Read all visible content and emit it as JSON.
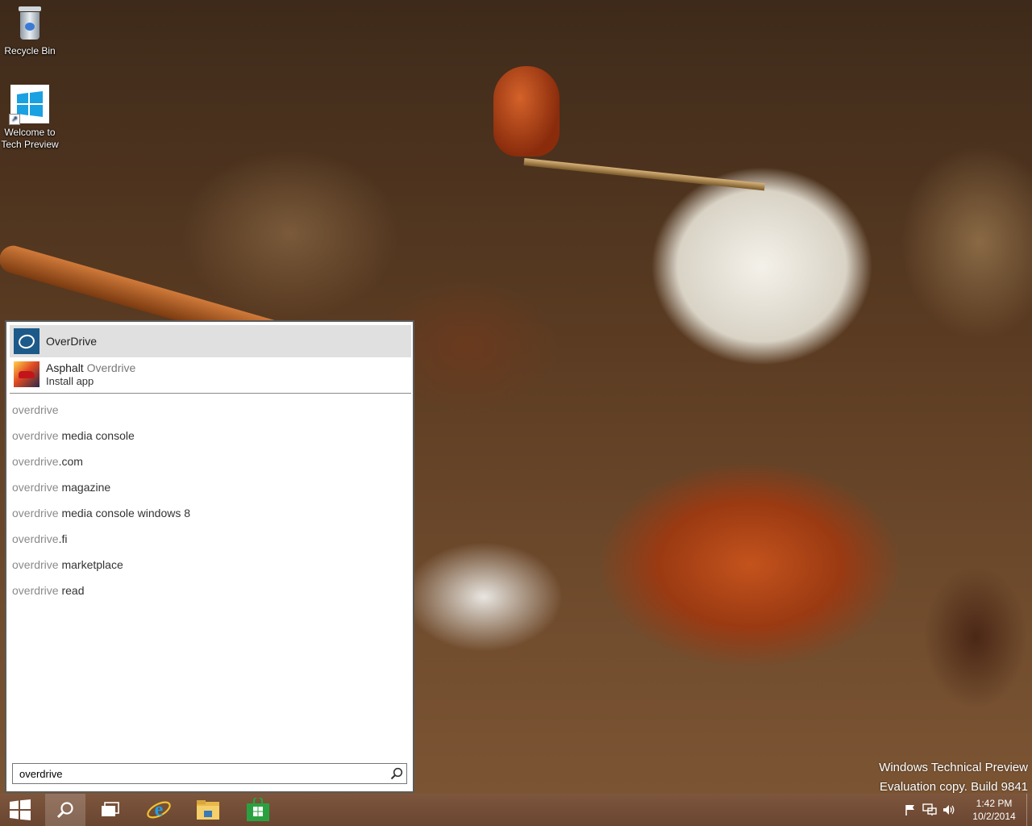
{
  "desktop": {
    "icons": [
      {
        "label": "Recycle Bin",
        "icon": "recycle-bin-icon"
      },
      {
        "label": "Welcome to Tech Preview",
        "icon": "windows-logo-icon"
      }
    ],
    "watermark": {
      "line1": "Windows Technical Preview",
      "line2": "Evaluation copy. Build 9841"
    }
  },
  "search_panel": {
    "results": [
      {
        "title": "OverDrive",
        "icon": "overdrive-app-icon",
        "selected": true
      },
      {
        "title_prefix": "Asphalt",
        "title_match": "Overdrive",
        "subtitle": "Install app",
        "icon": "asphalt-overdrive-icon"
      }
    ],
    "suggestions": [
      {
        "query": "overdrive",
        "rest": ""
      },
      {
        "query": "overdrive",
        "rest": " media console"
      },
      {
        "query": "overdrive",
        "rest": ".com"
      },
      {
        "query": "overdrive",
        "rest": " magazine"
      },
      {
        "query": "overdrive",
        "rest": " media console windows 8"
      },
      {
        "query": "overdrive",
        "rest": ".fi"
      },
      {
        "query": "overdrive",
        "rest": " marketplace"
      },
      {
        "query": "overdrive",
        "rest": " read"
      }
    ],
    "search_box": {
      "value": "overdrive",
      "icon": "search-icon"
    }
  },
  "taskbar": {
    "buttons": [
      {
        "name": "start-button",
        "icon": "windows-logo-icon"
      },
      {
        "name": "search-button",
        "icon": "search-icon",
        "active": true
      },
      {
        "name": "task-view-button",
        "icon": "task-view-icon"
      },
      {
        "name": "internet-explorer-button",
        "icon": "internet-explorer-icon"
      },
      {
        "name": "file-explorer-button",
        "icon": "folder-icon"
      },
      {
        "name": "store-button",
        "icon": "store-icon"
      }
    ],
    "tray": {
      "icons": [
        "flag-icon",
        "network-icon",
        "volume-icon"
      ],
      "time": "1:42 PM",
      "date": "10/2/2014"
    }
  },
  "colors": {
    "accent": "#1c5a8a",
    "taskbar": "#7a5240",
    "windows_blue": "#1aa1e1",
    "store_green": "#2aa140"
  }
}
